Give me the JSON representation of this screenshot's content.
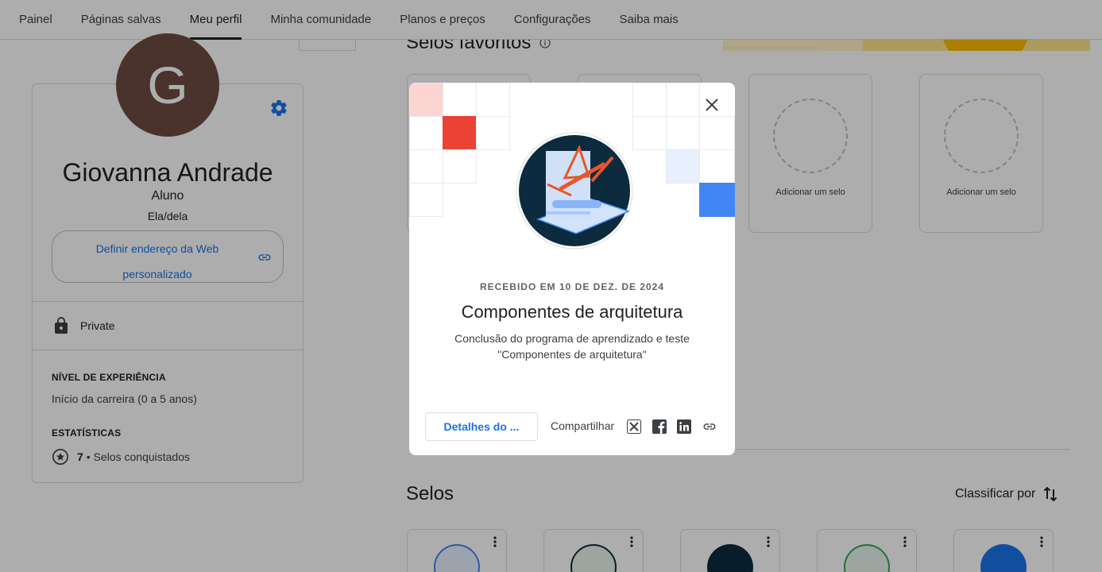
{
  "nav": {
    "items": [
      {
        "label": "Painel"
      },
      {
        "label": "Páginas salvas"
      },
      {
        "label": "Meu perfil",
        "active": true
      },
      {
        "label": "Minha comunidade"
      },
      {
        "label": "Planos e preços"
      },
      {
        "label": "Configurações"
      },
      {
        "label": "Saiba mais"
      }
    ]
  },
  "profile": {
    "avatar_initial": "G",
    "avatar_color": "#6d4c41",
    "name": "Giovanna Andrade",
    "role": "Aluno",
    "pronouns": "Ela/dela",
    "custom_url_button": "Definir endereço da Web personalizado",
    "privacy": "Private",
    "experience_label": "NÍVEL DE EXPERIÊNCIA",
    "experience_value": "Início da carreira (0 a 5 anos)",
    "stats_label": "ESTATÍSTICAS",
    "badges_count": "7",
    "badges_text": "• Selos conquistados",
    "icons": {
      "settings": "gear-icon",
      "link": "link-icon",
      "lock": "lock-icon",
      "star": "star-icon"
    }
  },
  "favorites": {
    "title": "Selos favoritos",
    "add_slot_label": "Adicionar um selo"
  },
  "badges_section": {
    "title": "Selos",
    "sort_label": "Classificar por"
  },
  "dialog": {
    "received_date": "RECEBIDO EM 10 DE DEZ. DE 2024",
    "title": "Componentes de arquitetura",
    "description": "Conclusão do programa de aprendizado e teste \"Componentes de arquitetura\"",
    "details_button": "Detalhes do ...",
    "share_label": "Compartilhar",
    "share_icons": [
      "x-icon",
      "facebook-icon",
      "linkedin-icon",
      "link-icon"
    ],
    "accent_colors": {
      "red": "#ea4335",
      "pink": "#fcd5d2",
      "blue": "#4285f4",
      "light_blue": "#e8f0fe",
      "navy": "#0d2b3e",
      "orange": "#e8562a"
    }
  }
}
